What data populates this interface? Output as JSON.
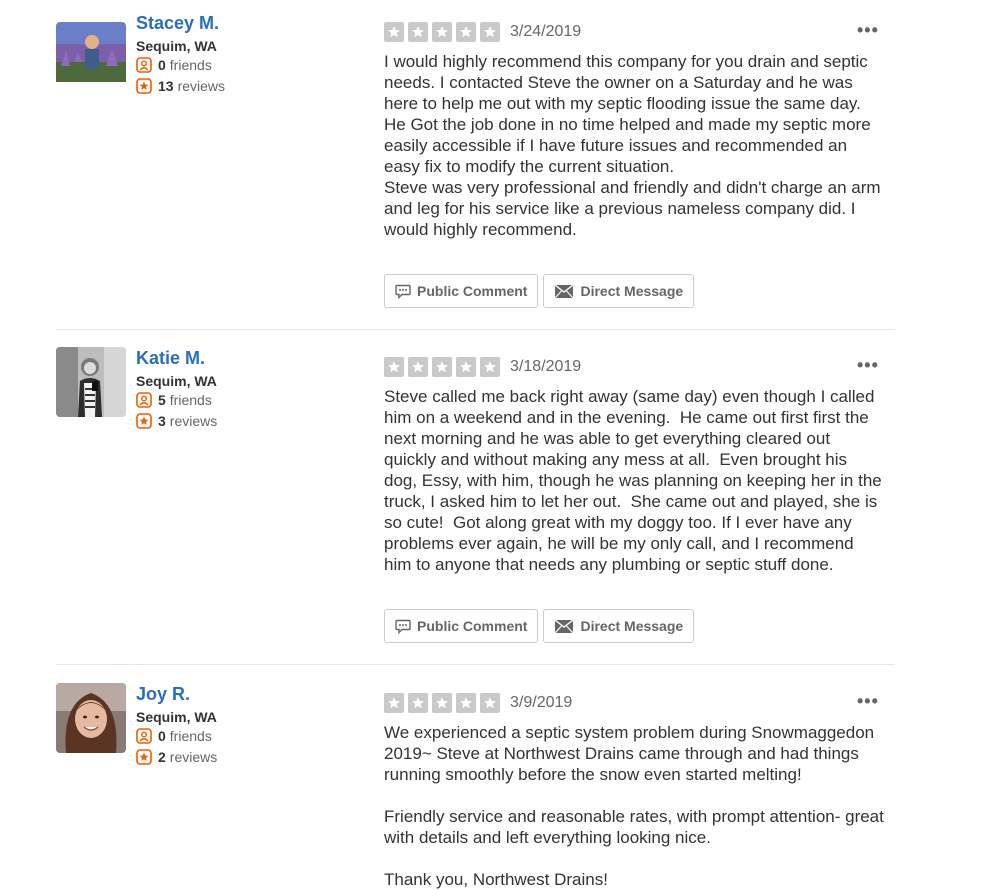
{
  "colors": {
    "user_link": "#2a6fb8",
    "star_box_empty": "#c9c9c9",
    "stat_icon": "#f15c00",
    "divider": "#e6e6e6"
  },
  "reviews": [
    {
      "user": {
        "name": "Stacey M.",
        "location": "Sequim, WA",
        "friends_count": "0",
        "friends_label": "friends",
        "reviews_count": "13",
        "reviews_label": "reviews"
      },
      "rating": 5,
      "date": "3/24/2019",
      "text": "I would highly recommend this company for you drain and septic needs. I contacted Steve the owner on a Saturday and he was here to help me out with my septic flooding issue the same day.\nHe Got the job done in no time helped and made my septic more easily accessible if I have future issues and recommended an easy fix to modify the current situation.\nSteve was very professional and friendly and didn't charge an arm and leg for his service like a previous nameless company did. I would highly recommend.",
      "public_comment_label": "Public Comment",
      "direct_message_label": "Direct Message",
      "more_label": "•••"
    },
    {
      "user": {
        "name": "Katie M.",
        "location": "Sequim, WA",
        "friends_count": "5",
        "friends_label": "friends",
        "reviews_count": "3",
        "reviews_label": "reviews"
      },
      "rating": 5,
      "date": "3/18/2019",
      "text": "Steve called me back right away (same day) even though I called him on a weekend and in the evening.  He came out first first the next morning and he was able to get everything cleared out quickly and without making any mess at all.  Even brought his dog, Essy, with him, though he was planning on keeping her in the truck, I asked him to let her out.  She came out and played, she is so cute!  Got along great with my doggy too. If I ever have any problems ever again, he will be my only call, and I recommend him to anyone that needs any plumbing or septic stuff done.",
      "public_comment_label": "Public Comment",
      "direct_message_label": "Direct Message",
      "more_label": "•••"
    },
    {
      "user": {
        "name": "Joy R.",
        "location": "Sequim, WA",
        "friends_count": "0",
        "friends_label": "friends",
        "reviews_count": "2",
        "reviews_label": "reviews"
      },
      "rating": 5,
      "date": "3/9/2019",
      "text": "We experienced a septic system problem during Snowmaggedon 2019~ Steve at Northwest Drains came through and had things running smoothly before the snow even started melting!\n\nFriendly service and reasonable rates, with prompt attention- great with details and left everything looking nice.\n\nThank you, Northwest Drains!",
      "more_label": "•••"
    }
  ]
}
